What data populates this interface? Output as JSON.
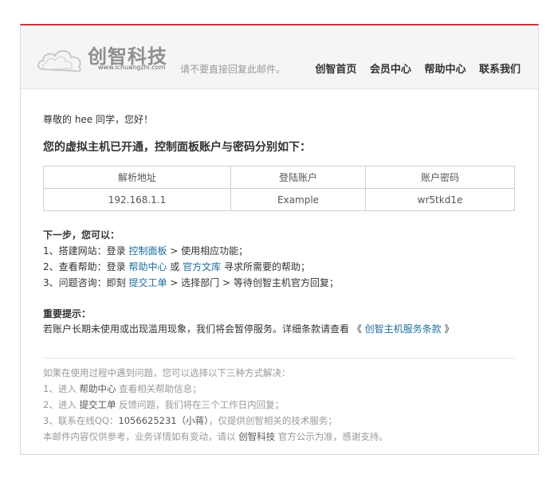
{
  "header": {
    "brand": "创智科技",
    "url": "www.ichuangzhi.com",
    "note": "请不要直接回复此邮件。",
    "nav": [
      "创智首页",
      "会员中心",
      "帮助中心",
      "联系我们"
    ]
  },
  "body": {
    "greeting": "尊敬的 hee 同学，您好！",
    "notice": "您的虚拟主机已开通，控制面板账户与密码分别如下：",
    "table": {
      "headers": [
        "解析地址",
        "登陆账户",
        "账户密码"
      ],
      "row": [
        "192.168.1.1",
        "Example",
        "wr5tkd1e"
      ]
    },
    "steps": {
      "title": "下一步，您可以：",
      "s1_pre": "1、搭建网站：登录 ",
      "s1_link": "控制面板",
      "s1_post": " > 使用相应功能；",
      "s2_pre": "2、查看帮助：登录 ",
      "s2_link1": "帮助中心",
      "s2_mid": " 或 ",
      "s2_link2": "官方文库",
      "s2_post": " 寻求所需要的帮助；",
      "s3_pre": "3、问题咨询：即刻 ",
      "s3_link": "提交工单",
      "s3_post": " > 选择部门 > 等待创智主机官方回复；"
    },
    "tips": {
      "title": "重要提示：",
      "text_pre": "若账户长期未使用或出现滥用现象，我们将会暂停服务。详细条款请查看 《 ",
      "link": "创智主机服务条款",
      "text_post": " 》"
    }
  },
  "footer": {
    "intro": "如果在使用过程中遇到问题，您可以选择以下三种方式解决：",
    "l1_pre": "1、进入 ",
    "l1_strong": "帮助中心",
    "l1_post": " 查看相关帮助信息；",
    "l2_pre": "2、进入 ",
    "l2_strong": "提交工单",
    "l2_post": " 反馈问题，我们将在三个工作日内回复；",
    "l3_pre": "3、联系在线QQ：",
    "l3_strong": "1056625231（小蒋）",
    "l3_post": "，仅提供创智相关的技术服务；",
    "l4_pre": "本邮件内容仅供参考，业务详情如有变动，请以 ",
    "l4_strong": "创智科技",
    "l4_post": " 官方公示为准，感谢支持。"
  },
  "colors": {
    "accent": "#c8363c",
    "link": "#1f6e9e"
  }
}
